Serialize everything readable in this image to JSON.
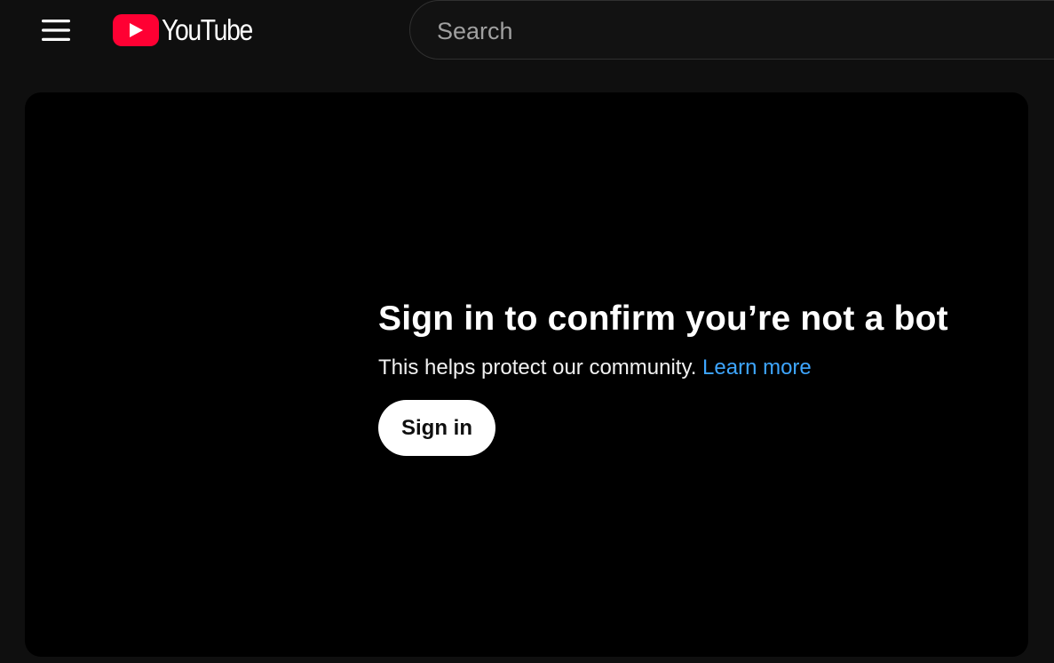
{
  "header": {
    "menu_icon": "hamburger-menu-icon",
    "logo_text": "YouTube",
    "logo_color": "#ff0033",
    "search": {
      "placeholder": "Search",
      "value": ""
    }
  },
  "main": {
    "headline": "Sign in to confirm you’re not a bot",
    "subtext": "This helps protect our community.",
    "learn_more_label": "Learn more",
    "sign_in_label": "Sign in",
    "link_color": "#3ea6ff"
  }
}
